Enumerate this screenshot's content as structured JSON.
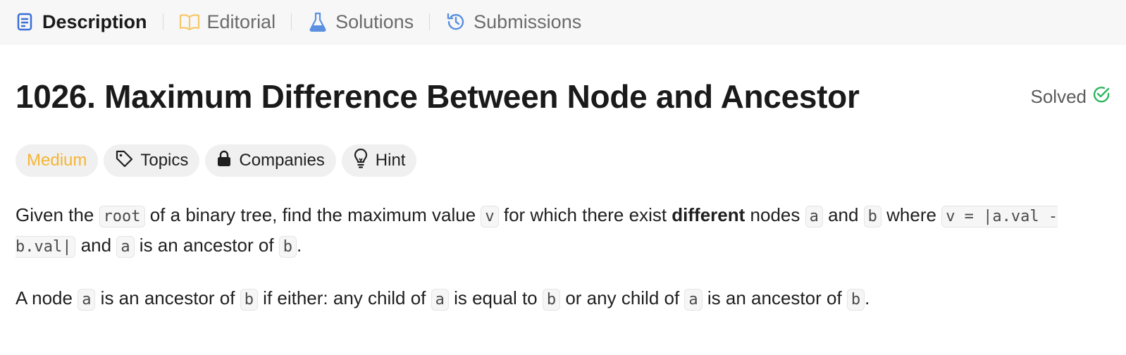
{
  "tabs": [
    {
      "label": "Description",
      "icon": "description-icon",
      "active": true
    },
    {
      "label": "Editorial",
      "icon": "book-icon",
      "active": false
    },
    {
      "label": "Solutions",
      "icon": "flask-icon",
      "active": false
    },
    {
      "label": "Submissions",
      "icon": "history-icon",
      "active": false
    }
  ],
  "problem": {
    "title": "1026. Maximum Difference Between Node and Ancestor",
    "status": "Solved",
    "difficulty": "Medium",
    "tags": [
      {
        "label": "Topics",
        "icon": "tag-icon"
      },
      {
        "label": "Companies",
        "icon": "lock-icon"
      },
      {
        "label": "Hint",
        "icon": "lightbulb-icon"
      }
    ]
  },
  "description": {
    "p1": {
      "t1": "Given the ",
      "c1": "root",
      "t2": " of a binary tree, find the maximum value ",
      "c2": "v",
      "t3": " for which there exist ",
      "b1": "different",
      "t4": " nodes ",
      "c3": "a",
      "t5": " and ",
      "c4": "b",
      "t6": " where ",
      "c5": "v = |a.val - b.val|",
      "t7": " and ",
      "c6": "a",
      "t8": " is an ancestor of ",
      "c7": "b",
      "t9": "."
    },
    "p2": {
      "t1": "A node ",
      "c1": "a",
      "t2": " is an ancestor of ",
      "c2": "b",
      "t3": " if either: any child of ",
      "c3": "a",
      "t4": " is equal to ",
      "c4": "b",
      "t5": " or any child of ",
      "c5": "a",
      "t6": " is an ancestor of ",
      "c6": "b",
      "t7": "."
    }
  },
  "colors": {
    "description_icon": "#3b6fd8",
    "editorial_icon": "#f5c86a",
    "solutions_icon": "#5b8fe0",
    "submissions_icon": "#5b8fe0",
    "solved_check": "#2db55d",
    "difficulty": "#f5b534"
  }
}
